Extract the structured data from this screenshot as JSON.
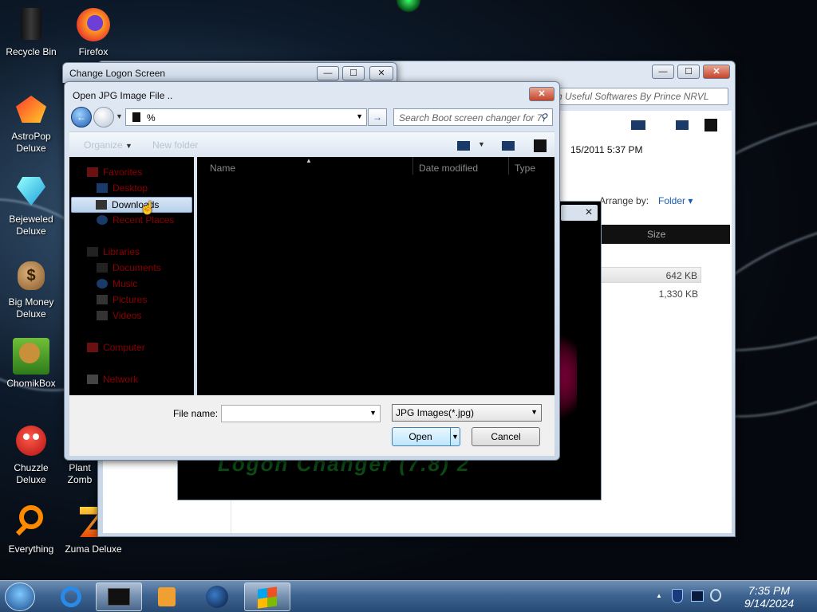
{
  "desktop": {
    "icons": [
      {
        "label": "Recycle Bin",
        "icon": "recycle-bin-icon"
      },
      {
        "label": "Firefox",
        "icon": "firefox-icon"
      },
      {
        "label": "AstroPop Deluxe",
        "icon": "astropop-icon"
      },
      {
        "label": "Bejeweled Deluxe",
        "icon": "bejeweled-icon"
      },
      {
        "label": "Big Money Deluxe",
        "icon": "money-bag-icon"
      },
      {
        "label": "ChomikBox",
        "icon": "chomikbox-icon"
      },
      {
        "label": "Chuzzle Deluxe",
        "icon": "chuzzle-icon"
      },
      {
        "label": "Plant Zomb",
        "icon": "plants-zombies-icon"
      },
      {
        "label": "Everything",
        "icon": "magnifier-icon"
      },
      {
        "label": "Zuma Deluxe",
        "icon": "zuma-icon"
      }
    ]
  },
  "back_window": {
    "search_placeholder": "ch Useful Softwares By Prince NRVL",
    "date_text": "15/2011 5:37 PM",
    "arrange_label": "Arrange by:",
    "arrange_value": "Folder",
    "size_header": "Size",
    "sizes": [
      "642 KB",
      "1,330 KB"
    ],
    "banner_text": "Logon Changer (7.8) 2"
  },
  "logon_window": {
    "title": "Change Logon Screen",
    "min": "—",
    "max": "☐",
    "close": "✕"
  },
  "dialog": {
    "title": "Open JPG Image File ..",
    "address_value": "%",
    "search_placeholder": "Search Boot screen changer for 7",
    "toolbar": {
      "organize": "Organize",
      "new_folder": "New folder"
    },
    "nav": {
      "favorites": "Favorites",
      "desktop": "Desktop",
      "downloads": "Downloads",
      "recent": "Recent Places",
      "libraries": "Libraries",
      "documents": "Documents",
      "music": "Music",
      "pictures": "Pictures",
      "videos": "Videos",
      "computer": "Computer",
      "network": "Network"
    },
    "columns": {
      "name": "Name",
      "date": "Date modified",
      "type": "Type"
    },
    "file_name_label": "File name:",
    "file_name_value": "",
    "filter_value": "JPG Images(*.jpg)",
    "open_label": "Open",
    "cancel_label": "Cancel"
  },
  "taskbar": {
    "time": "7:35 PM",
    "date": "9/14/2024"
  }
}
